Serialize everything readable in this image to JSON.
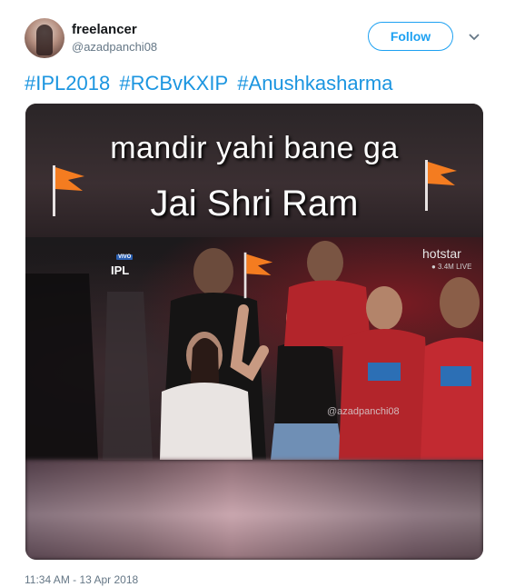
{
  "tweet": {
    "display_name": "freelancer",
    "handle": "@azadpanchi08",
    "follow_label": "Follow",
    "hashtags": [
      "#IPL2018",
      "#RCBvKXIP",
      "#Anushkasharma"
    ],
    "timestamp": "11:34 AM - 13 Apr 2018"
  },
  "media": {
    "caption_line1": "mandir yahi bane ga",
    "caption_line2": "Jai Shri Ram",
    "ipl_logo_text": "IPL",
    "ipl_logo_badge": "VIVO",
    "broadcaster": "hotstar",
    "live_viewers": "● 3.4M LIVE",
    "watermark": "@azadpanchi08",
    "flag_color": "#f47c20"
  },
  "icons": {
    "more": "chevron-down-icon",
    "flag": "saffron-flag-icon"
  },
  "colors": {
    "link": "#1da1f2",
    "hashtag": "#1b95e0",
    "secondary_text": "#657786"
  }
}
